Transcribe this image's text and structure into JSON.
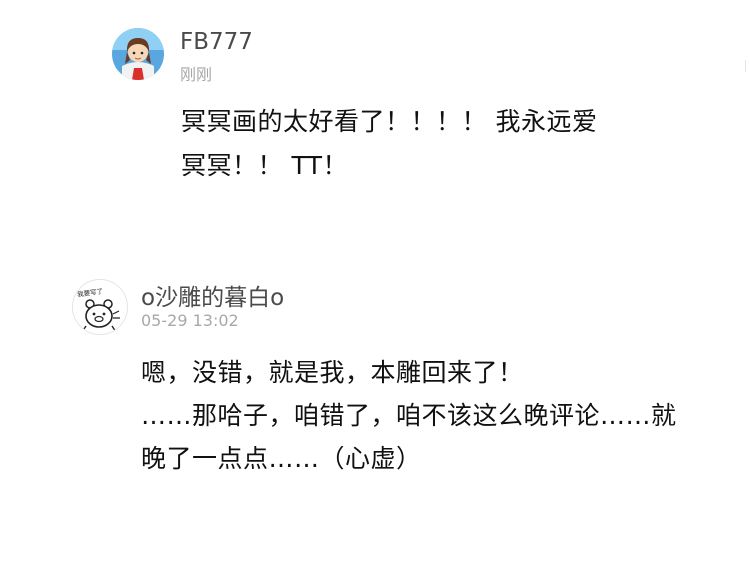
{
  "comments": [
    {
      "user": "FB777",
      "time": "刚刚",
      "avatar_icon": "anime-girl-avatar-icon",
      "lines": [
        "冥冥画的太好看了！！！！ 我永远爱",
        "冥冥！！ TT！"
      ]
    },
    {
      "user": "o沙雕的暮白o",
      "time": "05-29 13:02",
      "avatar_icon": "cartoon-bear-sticker-avatar-icon",
      "avatar_text": "我要写了",
      "lines": [
        "嗯，没错，就是我，本雕回来了！",
        "……那哈子，咱错了，咱不该这么晚评论……就",
        "晚了一点点……（心虚）"
      ]
    }
  ],
  "colors": {
    "username": "#4a4a4a",
    "timestamp": "#a8a8a8",
    "text": "#111111",
    "avatar1_sky": "#5aa7e0"
  }
}
